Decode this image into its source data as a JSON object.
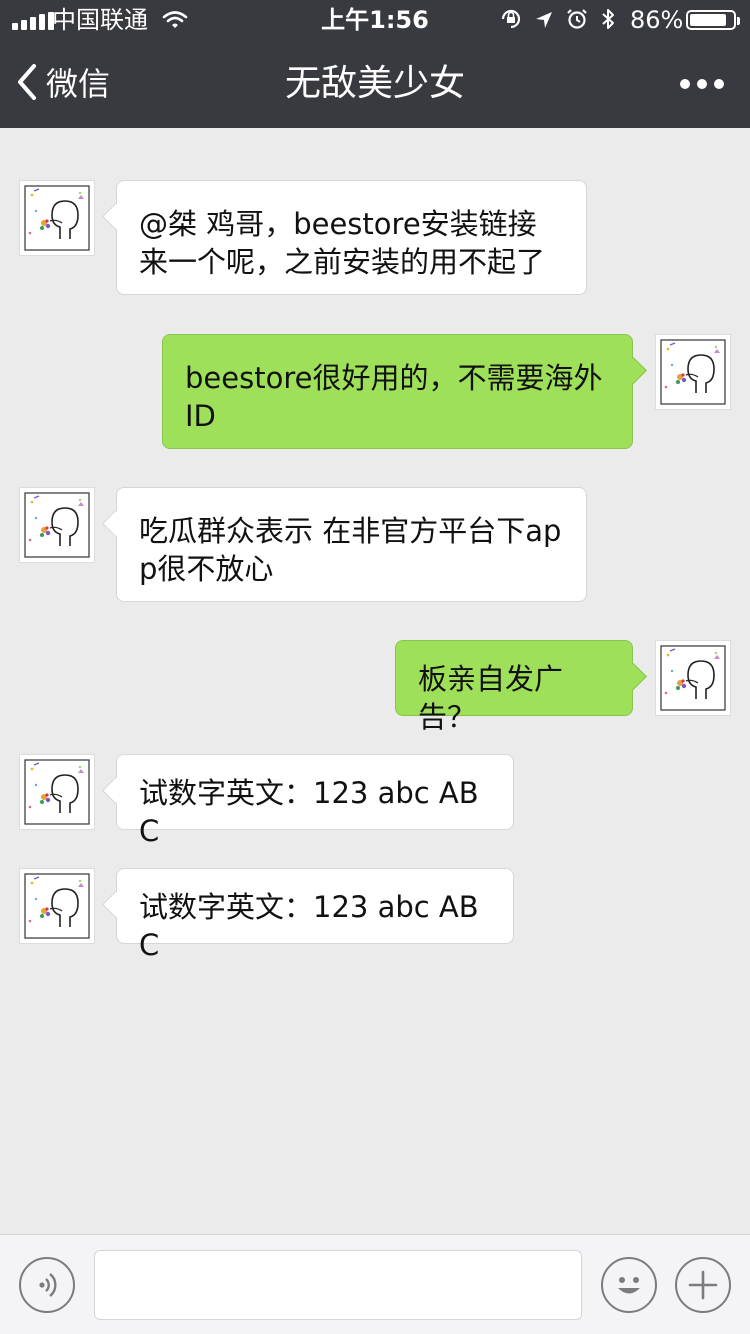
{
  "status_bar": {
    "carrier": "中国联通",
    "time": "上午1:56",
    "battery_percent": "86%",
    "battery_level": 0.86,
    "icons": [
      "signal-icon",
      "wifi-icon",
      "orientation-lock-icon",
      "location-icon",
      "alarm-icon",
      "bluetooth-icon",
      "battery-icon"
    ]
  },
  "nav": {
    "back_label": "微信",
    "title": "无敌美少女",
    "icons": [
      "back-chevron-icon",
      "more-icon"
    ]
  },
  "messages": [
    {
      "direction": "in",
      "text": "@桀 鸡哥，beestore安装链接来一个呢，之前安装的用不起了"
    },
    {
      "direction": "out",
      "text": "beestore很好用的，不需要海外ID"
    },
    {
      "direction": "in",
      "text": "吃瓜群众表示 在非官方平台下app很不放心"
    },
    {
      "direction": "out",
      "text": "板亲自发广告？"
    },
    {
      "direction": "in",
      "text": "试数字英文：123 abc ABC"
    },
    {
      "direction": "in",
      "text": "试数字英文：123 abc ABC"
    }
  ],
  "input_bar": {
    "value": "",
    "icons": [
      "voice-icon",
      "emoji-icon",
      "plus-icon"
    ]
  },
  "colors": {
    "nav_background": "#393a3f",
    "chat_background": "#ebebeb",
    "outgoing_bubble": "#9fe05a",
    "incoming_bubble": "#ffffff"
  }
}
